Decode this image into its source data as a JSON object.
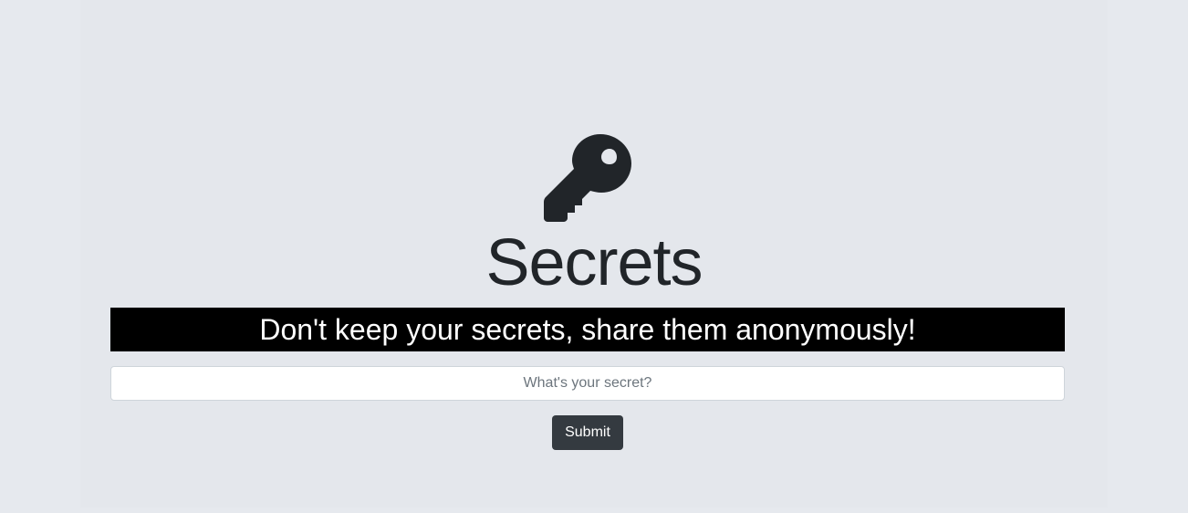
{
  "header": {
    "icon": "key-icon",
    "title": "Secrets"
  },
  "banner": {
    "text": "Don't keep your secrets, share them anonymously!"
  },
  "form": {
    "secret_placeholder": "What's your secret?",
    "secret_value": "",
    "submit_label": "Submit"
  },
  "colors": {
    "background": "#e6e9ee",
    "banner_bg": "#000000",
    "button_bg": "#343a40",
    "text_dark": "#212529"
  }
}
